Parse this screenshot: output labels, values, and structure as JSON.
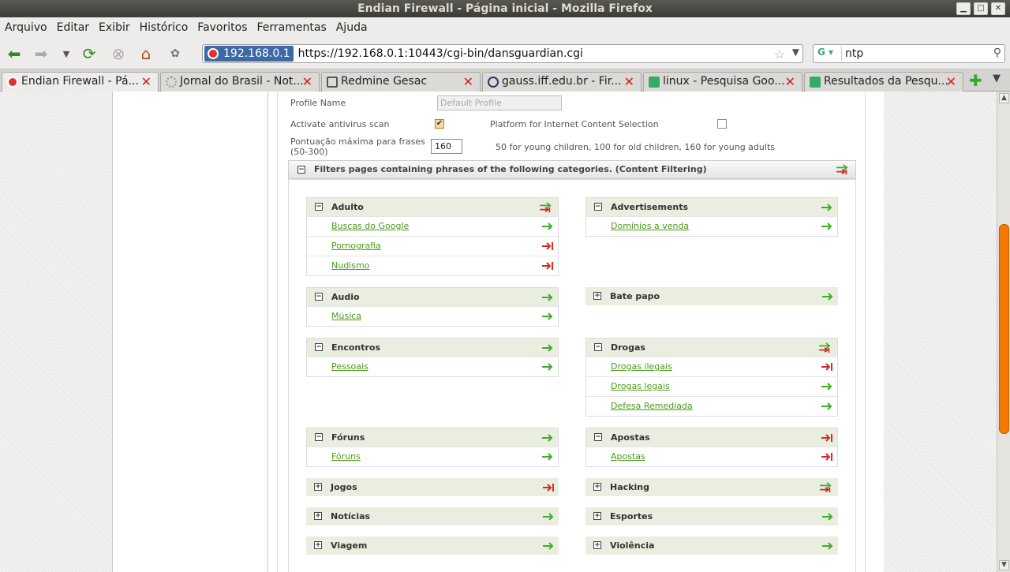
{
  "window": {
    "title": "Endian Firewall - Página inicial - Mozilla Firefox",
    "min": "▁",
    "max": "□",
    "close": "✕"
  },
  "menu": [
    "Arquivo",
    "Editar",
    "Exibir",
    "Histórico",
    "Favoritos",
    "Ferramentas",
    "Ajuda"
  ],
  "nav": {
    "back_icon": "back-arrow-icon",
    "forward_icon": "forward-arrow-icon",
    "reload_icon": "reload-icon",
    "stop_icon": "stop-icon",
    "home_icon": "home-icon",
    "url_host": "192.168.0.1",
    "url": "https://192.168.0.1:10443/cgi-bin/dansguardian.cgi",
    "search_engine": "G",
    "search_value": "ntp"
  },
  "tabs": [
    {
      "label": "Endian Firewall - Pá...",
      "active": true,
      "icon_color": "#d33"
    },
    {
      "label": "Jornal do Brasil - Not...",
      "active": false,
      "icon_color": "#bbb"
    },
    {
      "label": "Redmine Gesac",
      "active": false,
      "icon_color": "#777"
    },
    {
      "label": "gauss.iff.edu.br - Fir...",
      "active": false,
      "icon_color": "#336"
    },
    {
      "label": "linux - Pesquisa Goo...",
      "active": false,
      "icon_color": "#3a6"
    },
    {
      "label": "Resultados da Pesqu...",
      "active": false,
      "icon_color": "#3a6"
    }
  ],
  "form": {
    "profile_label": "Profile Name",
    "profile_placeholder": "Default Profile",
    "antivirus_label": "Activate antivirus scan",
    "antivirus_checked": true,
    "pics_label": "Platform for Internet Content Selection",
    "pics_checked": false,
    "score_label_1": "Pontuação máxima para frases",
    "score_label_2": "(50-300)",
    "score_value": "160",
    "score_hint": "50 for young children, 100 for old children, 160 for young adults"
  },
  "content_filter": {
    "header": "Filters pages containing phrases of the following categories. (Content Filtering)",
    "header_state": "mixed",
    "groups": [
      {
        "name": "Adulto",
        "open": true,
        "state": "mixed",
        "items": [
          {
            "label": "Buscas do Google",
            "state": "allow"
          },
          {
            "label": "Pornografia",
            "state": "block"
          },
          {
            "label": "Nudismo",
            "state": "block"
          }
        ]
      },
      {
        "name": "Advertisements",
        "open": true,
        "state": "allow",
        "items": [
          {
            "label": "Domínios a venda",
            "state": "allow"
          }
        ]
      },
      {
        "name": "Audio",
        "open": true,
        "state": "allow",
        "items": [
          {
            "label": "Música",
            "state": "allow"
          }
        ]
      },
      {
        "name": "Bate papo",
        "open": false,
        "state": "allow",
        "items": []
      },
      {
        "name": "Encontros",
        "open": true,
        "state": "allow",
        "items": [
          {
            "label": "Pessoais",
            "state": "allow"
          }
        ]
      },
      {
        "name": "Drogas",
        "open": true,
        "state": "mixed",
        "items": [
          {
            "label": "Drogas ilegais",
            "state": "block"
          },
          {
            "label": "Drogas legais",
            "state": "allow"
          },
          {
            "label": "Defesa Remediada",
            "state": "allow"
          }
        ]
      },
      {
        "name": "Fóruns",
        "open": true,
        "state": "allow",
        "items": [
          {
            "label": "Fóruns",
            "state": "allow"
          }
        ]
      },
      {
        "name": "Apostas",
        "open": true,
        "state": "block",
        "items": [
          {
            "label": "Apostas",
            "state": "block"
          }
        ]
      },
      {
        "name": "Jogos",
        "open": false,
        "state": "block",
        "items": []
      },
      {
        "name": "Hacking",
        "open": false,
        "state": "mixed",
        "items": []
      },
      {
        "name": "Notícias",
        "open": false,
        "state": "allow",
        "items": []
      },
      {
        "name": "Esportes",
        "open": false,
        "state": "allow",
        "items": []
      },
      {
        "name": "Viagem",
        "open": false,
        "state": "allow",
        "items": []
      },
      {
        "name": "Violência",
        "open": false,
        "state": "allow",
        "items": []
      }
    ]
  },
  "colors": {
    "allow": "#3fae2a",
    "block": "#d62b2b",
    "accent": "#f57900",
    "selection": "#3c6aa6"
  }
}
